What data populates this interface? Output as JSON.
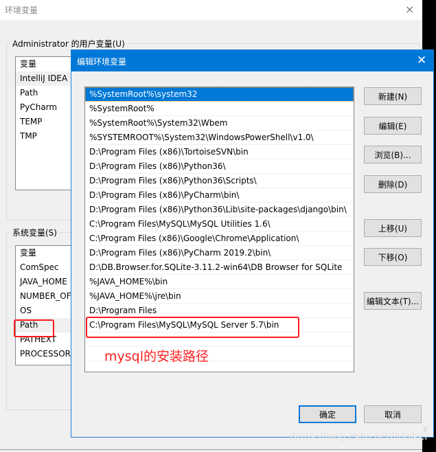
{
  "background_window": {
    "title": "环境变量",
    "close_icon": "×",
    "user_vars": {
      "group_label": "Administrator 的用户变量(U)",
      "column_header": "变量",
      "items": [
        "IntelliJ IDEA",
        "Path",
        "PyCharm",
        "TEMP",
        "TMP"
      ]
    },
    "system_vars": {
      "group_label": "系统变量(S)",
      "column_header": "变量",
      "items": [
        "ComSpec",
        "JAVA_HOME",
        "NUMBER_OF",
        "OS",
        "Path",
        "PATHEXT",
        "PROCESSOR_"
      ]
    }
  },
  "dialog": {
    "title": "编辑环境变量",
    "close_icon": "✕",
    "paths": [
      "%SystemRoot%\\system32",
      "%SystemRoot%",
      "%SystemRoot%\\System32\\Wbem",
      "%SYSTEMROOT%\\System32\\WindowsPowerShell\\v1.0\\",
      "D:\\Program Files (x86)\\TortoiseSVN\\bin",
      "D:\\Program Files (x86)\\Python36\\",
      "D:\\Program Files (x86)\\Python36\\Scripts\\",
      "D:\\Program Files (x86)\\PyCharm\\bin\\",
      "D:\\Program Files (x86)\\Python36\\Lib\\site-packages\\django\\bin\\",
      "C:\\Program Files\\MySQL\\MySQL Utilities 1.6\\",
      "C:\\Program Files (x86)\\Google\\Chrome\\Application\\",
      "D:\\Program Files (x86)\\PyCharm 2019.2\\bin\\",
      "D:\\DB.Browser.for.SQLite-3.11.2-win64\\DB Browser for SQLite",
      "%JAVA_HOME%\\bin",
      "%JAVA_HOME%\\jre\\bin",
      "D:\\Program Files",
      "C:\\Program Files\\MySQL\\MySQL Server 5.7\\bin",
      "",
      "",
      ""
    ],
    "selected_index": 0,
    "buttons": {
      "new": "新建(N)",
      "edit": "编辑(E)",
      "browse": "浏览(B)...",
      "delete": "删除(D)",
      "move_up": "上移(U)",
      "move_down": "下移(O)",
      "edit_text": "编辑文本(T)...",
      "ok": "确定",
      "cancel": "取消"
    }
  },
  "annotation": {
    "text": "mysql的安装路径",
    "color": "#ff2020"
  },
  "watermark": "https://blog.csdn.net/liuqiker",
  "colors": {
    "accent": "#0078d7",
    "highlight_box": "#ff1a1a"
  }
}
